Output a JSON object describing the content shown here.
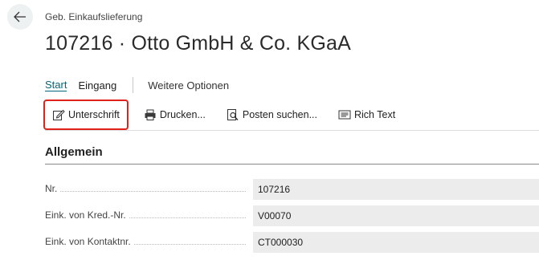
{
  "header": {
    "breadcrumb": "Geb. Einkaufslieferung",
    "title": "107216 · Otto GmbH & Co. KGaA"
  },
  "tabs": [
    {
      "label": "Start",
      "active": true
    },
    {
      "label": "Eingang",
      "active": false
    },
    {
      "label": "Weitere Optionen",
      "active": false
    }
  ],
  "actions": [
    {
      "label": "Unterschrift",
      "icon": "signature-edit-icon",
      "highlighted": true
    },
    {
      "label": "Drucken...",
      "icon": "printer-icon"
    },
    {
      "label": "Posten suchen...",
      "icon": "find-entries-icon"
    },
    {
      "label": "Rich Text",
      "icon": "rich-text-icon"
    }
  ],
  "section": {
    "title": "Allgemein",
    "fields": [
      {
        "label": "Nr.",
        "value": "107216"
      },
      {
        "label": "Eink. von Kred.-Nr.",
        "value": "V00070"
      },
      {
        "label": "Eink. von Kontaktnr.",
        "value": "CT000030"
      }
    ]
  },
  "colors": {
    "accent": "#00677a",
    "highlight_border": "#e0221a",
    "field_background": "#ececec"
  }
}
